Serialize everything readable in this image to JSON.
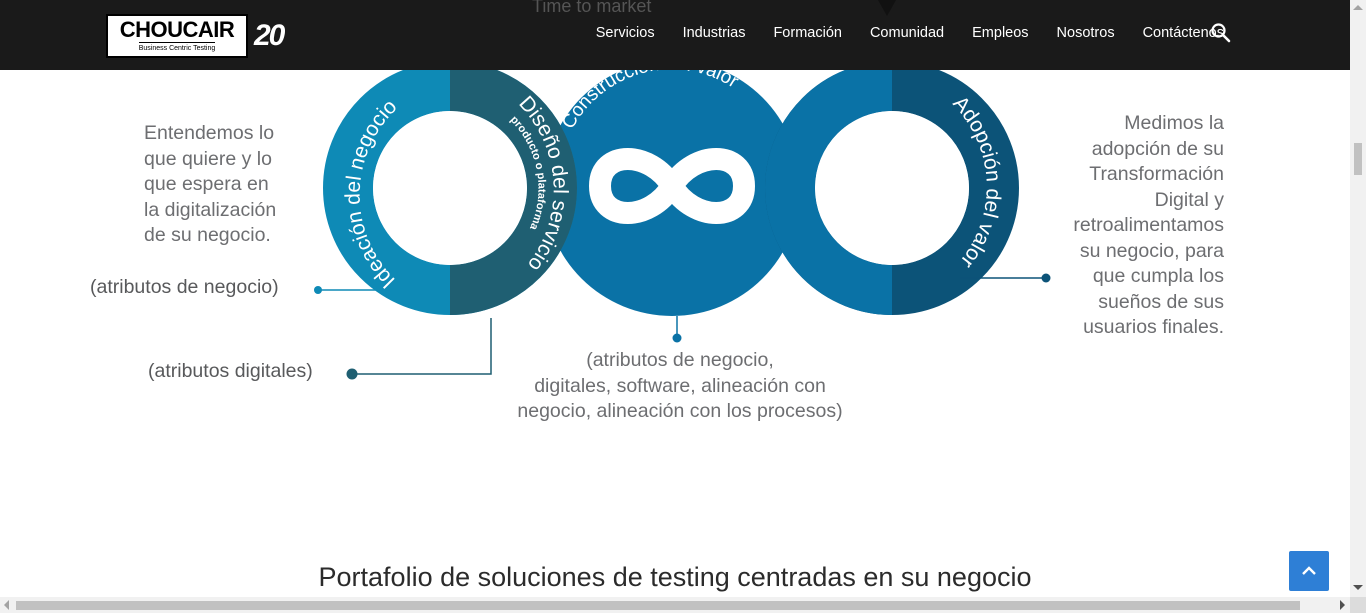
{
  "header": {
    "logo_text": "CHOUCAIR",
    "logo_tagline": "Business Centric Testing",
    "logo_anniversary": "20",
    "nav": [
      "Servicios",
      "Industrias",
      "Formación",
      "Comunidad",
      "Empleos",
      "Nosotros",
      "Contáctenos"
    ],
    "search_icon": "search-icon"
  },
  "diagram": {
    "background_fragment": "Time to market",
    "ring_labels": {
      "ideation": "Ideación del negocio",
      "design": "Diseño del servicio",
      "design_sub": "producto o plataforma",
      "construction": "Construcción del valor",
      "adoption": "Adopción del valor"
    },
    "left_text": [
      "Entendemos lo",
      "que quiere y lo",
      "que espera en",
      "la digitalización",
      "de su negocio."
    ],
    "right_text": [
      "Medimos la",
      "adopción de su",
      "Transformación",
      "Digital y",
      "retroalimentamos",
      "su negocio, para",
      "que cumpla los",
      "sueños de sus",
      "usuarios finales."
    ],
    "attr_business": "(atributos de negocio)",
    "attr_digital": "(atributos digitales)",
    "bottom_text": [
      "(atributos de negocio,",
      "digitales, software, alineación con",
      "negocio, alineación con los procesos)"
    ],
    "colors": {
      "teal_light": "#0e8ab6",
      "teal_dark": "#1f5f72",
      "blue_mid": "#0a72a6",
      "navy": "#0c5378",
      "text_gray": "#6d6e71"
    }
  },
  "section": {
    "title": "Portafolio de soluciones de testing centradas en su negocio"
  },
  "back_to_top": {
    "icon": "chevron-up-icon"
  }
}
